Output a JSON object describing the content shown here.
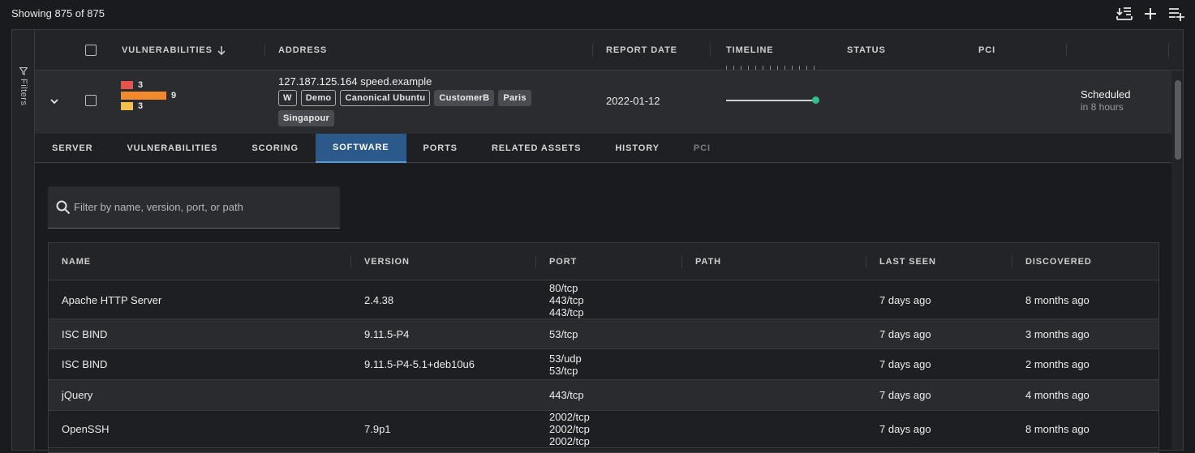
{
  "toolbar": {
    "showing_text": "Showing 875 of 875",
    "icons": [
      "download-list-icon",
      "plus-icon",
      "add-to-list-icon"
    ]
  },
  "filters": {
    "label": "Filters"
  },
  "header": {
    "columns": [
      "VULNERABILITIES",
      "ADDRESS",
      "REPORT DATE",
      "TIMELINE",
      "STATUS",
      "PCI"
    ],
    "sort_icon": "arrow-down-icon"
  },
  "asset": {
    "vuln_counts": [
      {
        "count": "3",
        "color": "#e8534a",
        "fraction": 0.27
      },
      {
        "count": "9",
        "color": "#f08a2c",
        "fraction": 1.0
      },
      {
        "count": "3",
        "color": "#f5c04a",
        "fraction": 0.27
      }
    ],
    "address": "127.187.125.164 speed.example",
    "tags": [
      {
        "label": "W",
        "style": "outline"
      },
      {
        "label": "Demo",
        "style": "outline"
      },
      {
        "label": "Canonical Ubuntu",
        "style": "outline"
      },
      {
        "label": "CustomerB",
        "style": "filled"
      },
      {
        "label": "Paris",
        "style": "filled"
      },
      {
        "label": "Singapour",
        "style": "filled"
      }
    ],
    "report_date": "2022-01-12",
    "status_main": "Scheduled",
    "status_sub": "in 8 hours"
  },
  "tabs": [
    {
      "label": "SERVER",
      "state": "normal"
    },
    {
      "label": "VULNERABILITIES",
      "state": "normal"
    },
    {
      "label": "SCORING",
      "state": "normal"
    },
    {
      "label": "SOFTWARE",
      "state": "active"
    },
    {
      "label": "PORTS",
      "state": "normal"
    },
    {
      "label": "RELATED ASSETS",
      "state": "normal"
    },
    {
      "label": "HISTORY",
      "state": "normal"
    },
    {
      "label": "PCI",
      "state": "disabled"
    }
  ],
  "software": {
    "search_placeholder": "Filter by name, version, port, or path",
    "columns": [
      "NAME",
      "VERSION",
      "PORT",
      "PATH",
      "LAST SEEN",
      "DISCOVERED"
    ],
    "rows": [
      {
        "name": "Apache HTTP Server",
        "version": "2.4.38",
        "ports": [
          "80/tcp",
          "443/tcp",
          "443/tcp"
        ],
        "path": "",
        "last_seen": "7 days ago",
        "discovered": "8 months ago"
      },
      {
        "name": "ISC BIND",
        "version": "9.11.5-P4",
        "ports": [
          "53/tcp"
        ],
        "path": "",
        "last_seen": "7 days ago",
        "discovered": "3 months ago"
      },
      {
        "name": "ISC BIND",
        "version": "9.11.5-P4-5.1+deb10u6",
        "ports": [
          "53/udp",
          "53/tcp"
        ],
        "path": "",
        "last_seen": "7 days ago",
        "discovered": "2 months ago"
      },
      {
        "name": "jQuery",
        "version": "",
        "ports": [
          "443/tcp"
        ],
        "path": "",
        "last_seen": "7 days ago",
        "discovered": "4 months ago"
      },
      {
        "name": "OpenSSH",
        "version": "7.9p1",
        "ports": [
          "2002/tcp",
          "2002/tcp",
          "2002/tcp"
        ],
        "path": "",
        "last_seen": "7 days ago",
        "discovered": "8 months ago"
      }
    ]
  }
}
